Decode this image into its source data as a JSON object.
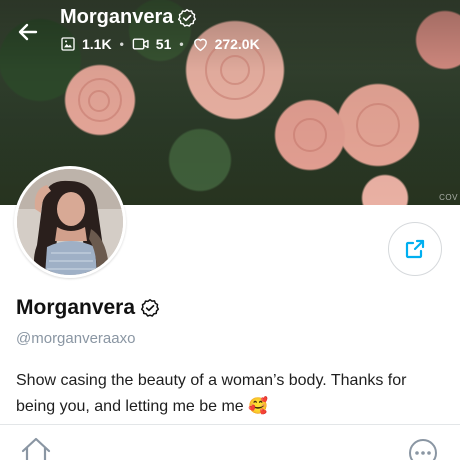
{
  "header": {
    "title": "Morganvera",
    "stats": {
      "photos": "1.1K",
      "videos": "51",
      "likes": "272.0K"
    },
    "cover_watermark": "COV"
  },
  "profile": {
    "display_name": "Morganvera",
    "handle": "@morganveraaxo",
    "bio": "Show casing the beauty of a woman’s body. Thanks for being you, and letting me be me 🥰"
  },
  "icons": {
    "back": "arrow-left-icon",
    "verified": "verified-badge-icon",
    "photos": "image-icon",
    "videos": "video-icon",
    "likes": "heart-icon",
    "share": "share-icon",
    "home": "home-icon",
    "more": "more-icon"
  },
  "colors": {
    "accent": "#00aff0",
    "muted": "#8a96a3",
    "text": "#1a1a1a"
  }
}
